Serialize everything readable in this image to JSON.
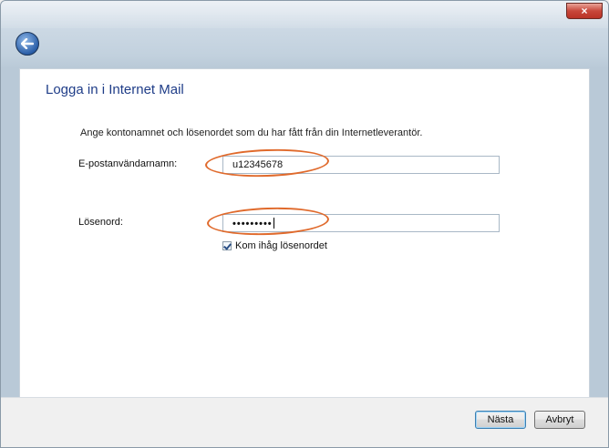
{
  "window": {
    "close_label": "×"
  },
  "nav": {
    "back_icon": "back-arrow-icon"
  },
  "page": {
    "heading": "Logga in i Internet Mail",
    "intro": "Ange kontonamnet och lösenordet som du har fått från din Internetleverantör."
  },
  "form": {
    "email_label": "E-postanvändarnamn:",
    "email_value": "u12345678",
    "password_label": "Lösenord:",
    "password_value": "•••••••••",
    "remember_label": "Kom ihåg lösenordet",
    "remember_checked": true
  },
  "buttons": {
    "next_label": "Nästa",
    "cancel_label": "Avbryt"
  },
  "colors": {
    "heading": "#1f3d88",
    "highlight": "#e06a2c",
    "close": "#c8473a"
  }
}
